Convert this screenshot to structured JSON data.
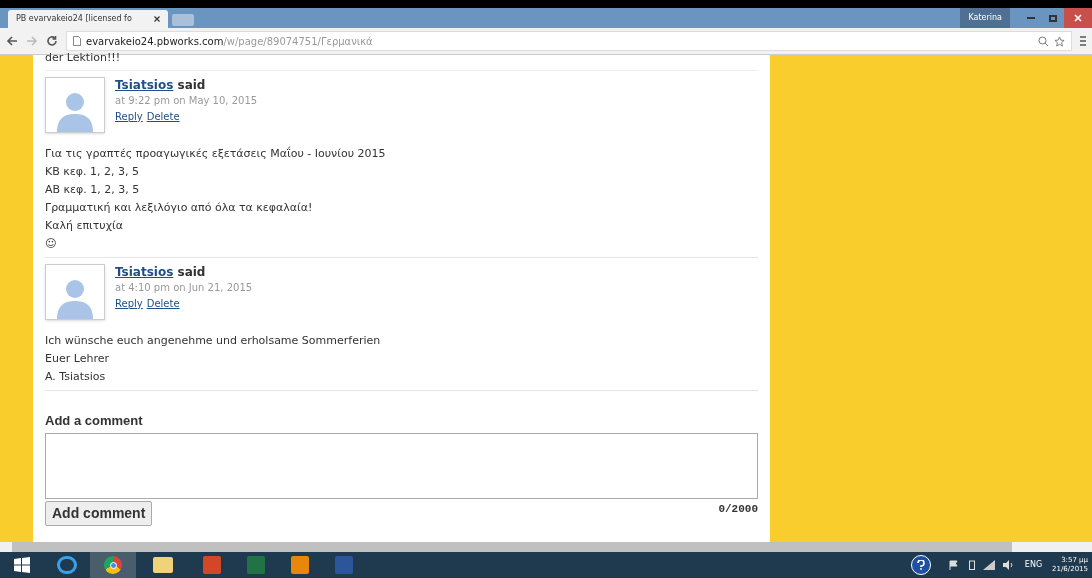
{
  "browser": {
    "tab_title": "PB evarvakeio24 [licensed fo",
    "url_host": "evarvakeio24.pbworks.com",
    "url_path": "/w/page/89074751/Γερμανικά",
    "user": "Katerina"
  },
  "top_text": "der Lektion!!!",
  "comments": [
    {
      "author": "Tsiatsios",
      "said": "said",
      "time": "at 9:22 pm on May 10, 2015",
      "actions": [
        "Reply",
        "Delete"
      ],
      "lines": [
        "Για τις γραπτές προαγωγικές εξετάσεις Μαΐου - Ιουνίου 2015",
        "ΚΒ κεφ. 1, 2, 3, 5",
        "ΑΒ κεφ. 1, 2, 3, 5",
        "Γραμματική και λεξιλόγιο από όλα τα κεφαλαία!",
        "Καλή επιτυχία",
        "☺"
      ]
    },
    {
      "author": "Tsiatsios",
      "said": "said",
      "time": "at 4:10 pm on Jun 21, 2015",
      "actions": [
        "Reply",
        "Delete"
      ],
      "lines": [
        "Ich wünsche euch angenehme und erholsame Sommerferien",
        "Euer Lehrer",
        "A. Tsiatsios"
      ]
    }
  ],
  "add_comment": {
    "heading": "Add a comment",
    "button": "Add comment",
    "counter": "0/2000"
  },
  "tray": {
    "lang": "ENG",
    "time": "3:57 μμ",
    "date": "21/6/2015"
  }
}
